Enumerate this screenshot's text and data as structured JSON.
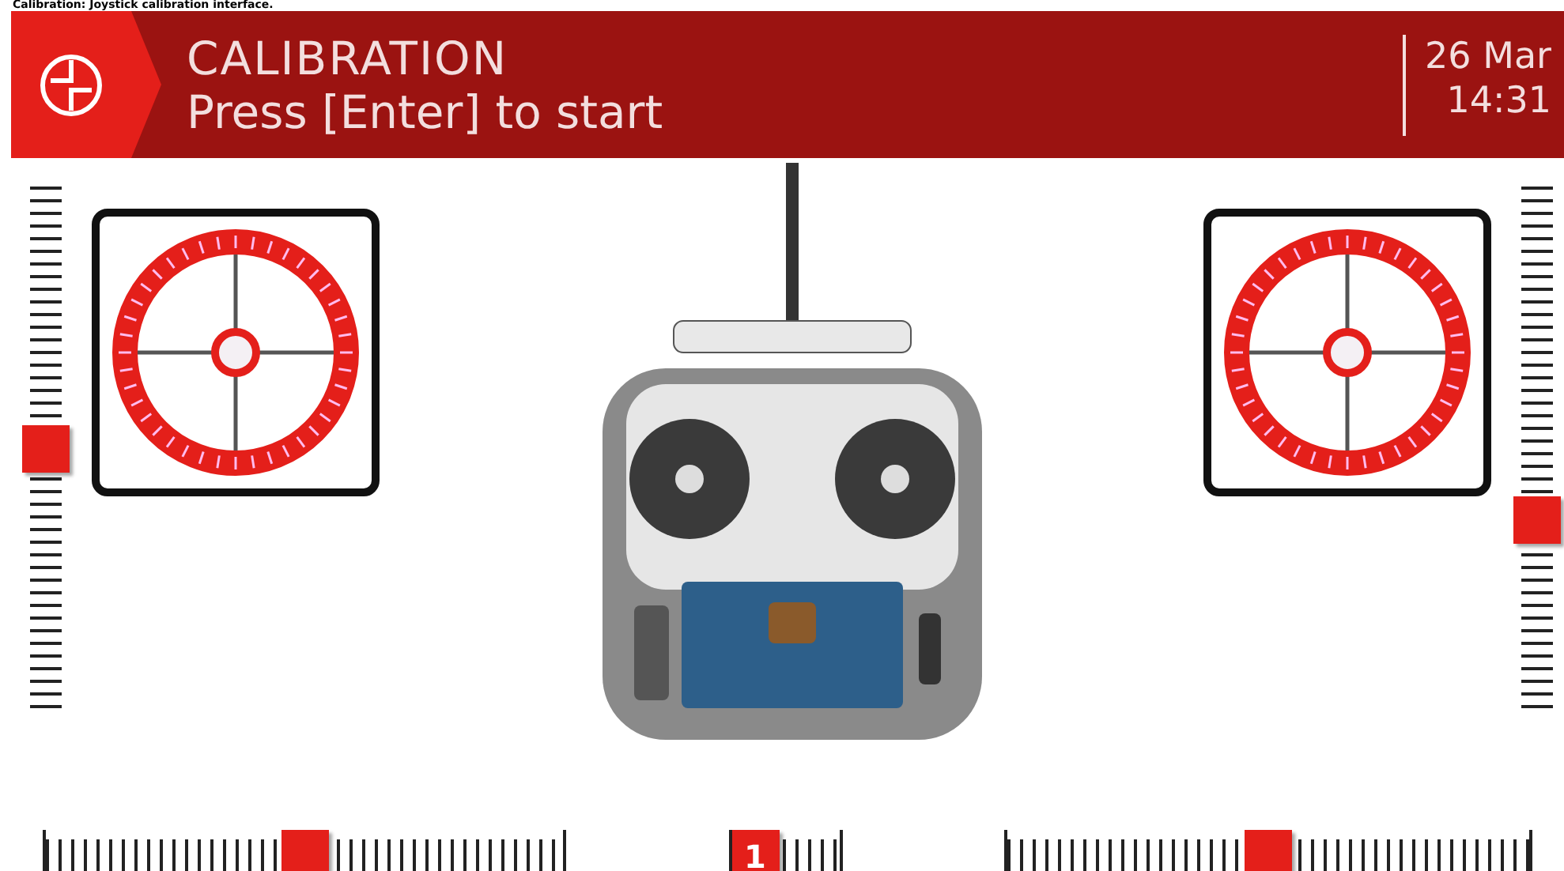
{
  "caption": "Calibration: Joystick calibration interface.",
  "header": {
    "title": "CALIBRATION",
    "subtitle": "Press [Enter] to start",
    "date": "26 Mar",
    "time": "14:31"
  },
  "vertical_sliders": [
    {
      "level": 0.5
    },
    {
      "level": 0.35
    }
  ],
  "sticks": [
    {
      "kind": "stick"
    },
    {
      "kind": "stick"
    }
  ],
  "horizontal_sliders": [
    {
      "level": 0.5
    },
    {
      "level": 0,
      "label": "1"
    },
    {
      "level": 0.5
    }
  ]
}
